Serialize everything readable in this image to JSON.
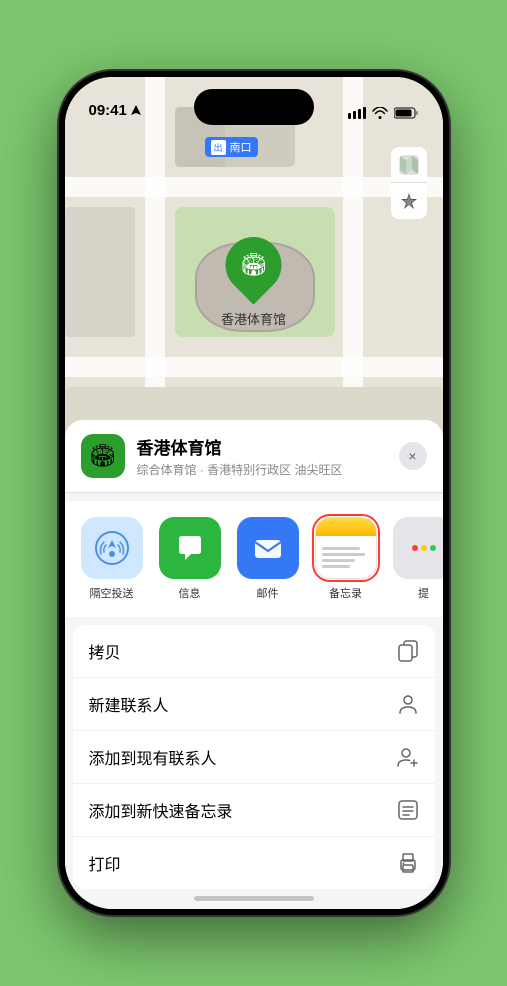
{
  "status_bar": {
    "time": "09:41",
    "location_arrow": "▶",
    "signal": "▌▌▌",
    "wifi": "wifi",
    "battery": "battery"
  },
  "map": {
    "label_text": "南口",
    "label_prefix": "出",
    "pin_label": "香港体育馆",
    "controls": {
      "map_icon": "🗺",
      "location_icon": "⬆"
    }
  },
  "venue_card": {
    "name": "香港体育馆",
    "subtitle": "综合体育馆 · 香港特别行政区 油尖旺区",
    "close_label": "×"
  },
  "share_items": [
    {
      "id": "airdrop",
      "label": "隔空投送",
      "selected": false
    },
    {
      "id": "messages",
      "label": "信息",
      "selected": false
    },
    {
      "id": "mail",
      "label": "邮件",
      "selected": false
    },
    {
      "id": "notes",
      "label": "备忘录",
      "selected": true
    },
    {
      "id": "more",
      "label": "提",
      "selected": false
    }
  ],
  "actions": [
    {
      "id": "copy",
      "label": "拷贝",
      "icon": "copy"
    },
    {
      "id": "new-contact",
      "label": "新建联系人",
      "icon": "person"
    },
    {
      "id": "add-contact",
      "label": "添加到现有联系人",
      "icon": "person-add"
    },
    {
      "id": "quick-note",
      "label": "添加到新快速备忘录",
      "icon": "note"
    },
    {
      "id": "print",
      "label": "打印",
      "icon": "print"
    }
  ]
}
